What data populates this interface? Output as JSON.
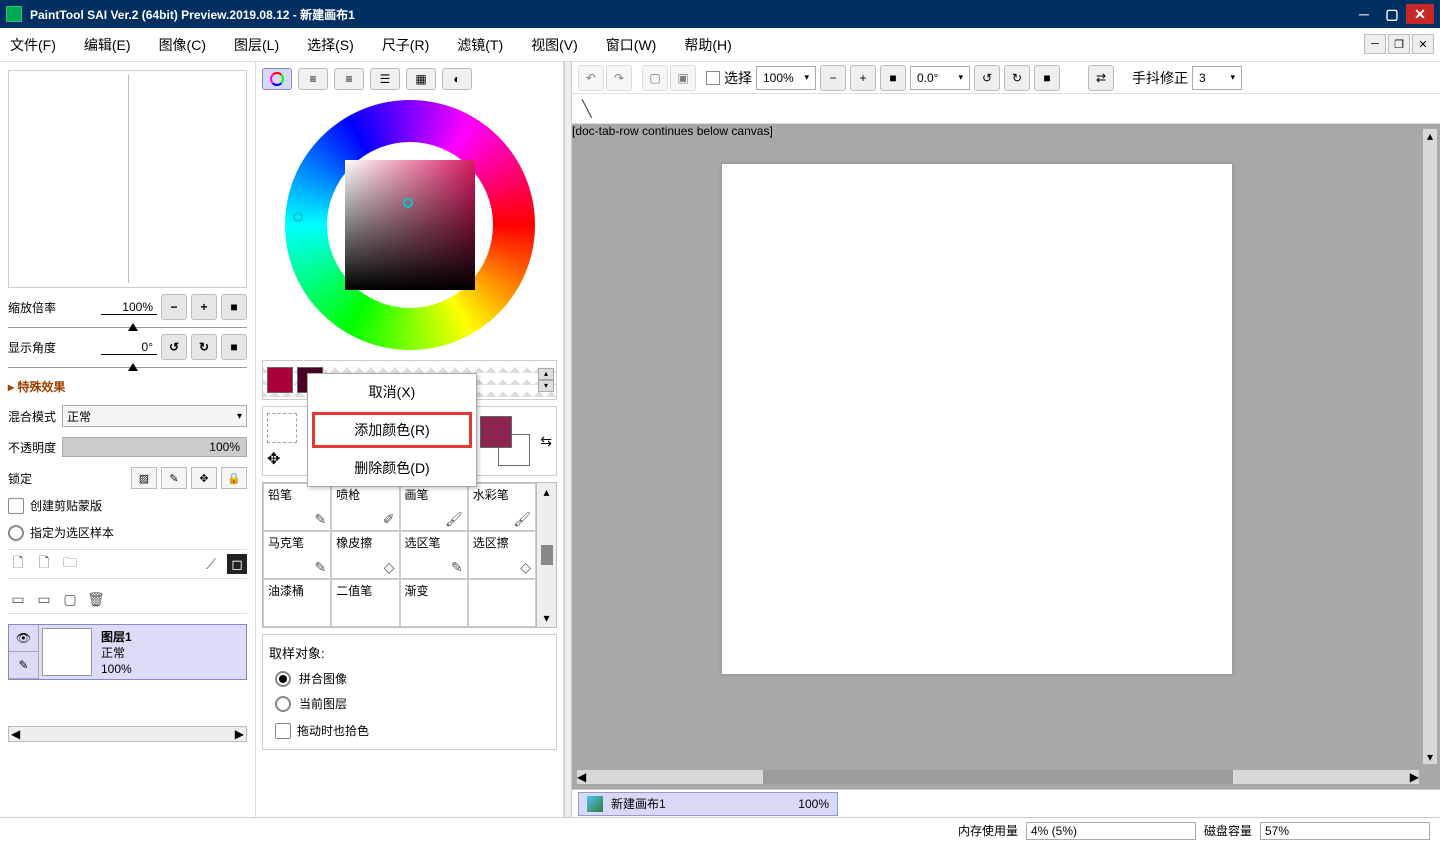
{
  "title": "PaintTool SAI Ver.2 (64bit) Preview.2019.08.12 - 新建画布1",
  "menu": {
    "file": "文件(F)",
    "edit": "编辑(E)",
    "image": "图像(C)",
    "layer": "图层(L)",
    "select": "选择(S)",
    "ruler": "尺子(R)",
    "filter": "滤镜(T)",
    "view": "视图(V)",
    "window": "窗口(W)",
    "help": "帮助(H)"
  },
  "nav": {
    "zoom_label": "缩放倍率",
    "zoom_value": "100%",
    "angle_label": "显示角度",
    "angle_value": "0°"
  },
  "effects": {
    "header": "▸ 特殊效果"
  },
  "blend": {
    "label": "混合模式",
    "value": "正常"
  },
  "opacity": {
    "label": "不透明度",
    "value": "100%"
  },
  "lock": {
    "label": "锁定"
  },
  "options": {
    "clipping": "创建剪贴蒙版",
    "sample": "指定为选区样本"
  },
  "layer": {
    "name": "图层1",
    "mode": "正常",
    "opacity": "100%"
  },
  "context": {
    "cancel": "取消(X)",
    "add": "添加颜色(R)",
    "del": "删除颜色(D)"
  },
  "brushes": {
    "b0": "铅笔",
    "b1": "喷枪",
    "b2": "画笔",
    "b3": "水彩笔",
    "b4": "马克笔",
    "b5": "橡皮擦",
    "b6": "选区笔",
    "b7": "选区擦",
    "b8": "油漆桶",
    "b9": "二值笔",
    "b10": "渐变"
  },
  "sampling": {
    "label": "取样对象:",
    "merged": "拼合图像",
    "current": "当前图层",
    "drag": "拖动时也拾色"
  },
  "toolbar": {
    "select": "选择",
    "zoom": "100%",
    "angle": "0.0°",
    "stabilizer_label": "手抖修正",
    "stabilizer_value": "3"
  },
  "doc": {
    "name": "新建画布1",
    "zoom": "100%"
  },
  "status": {
    "mem_label": "内存使用量",
    "mem_value": "4% (5%)",
    "disk_label": "磁盘容量",
    "disk_value": "57%"
  }
}
